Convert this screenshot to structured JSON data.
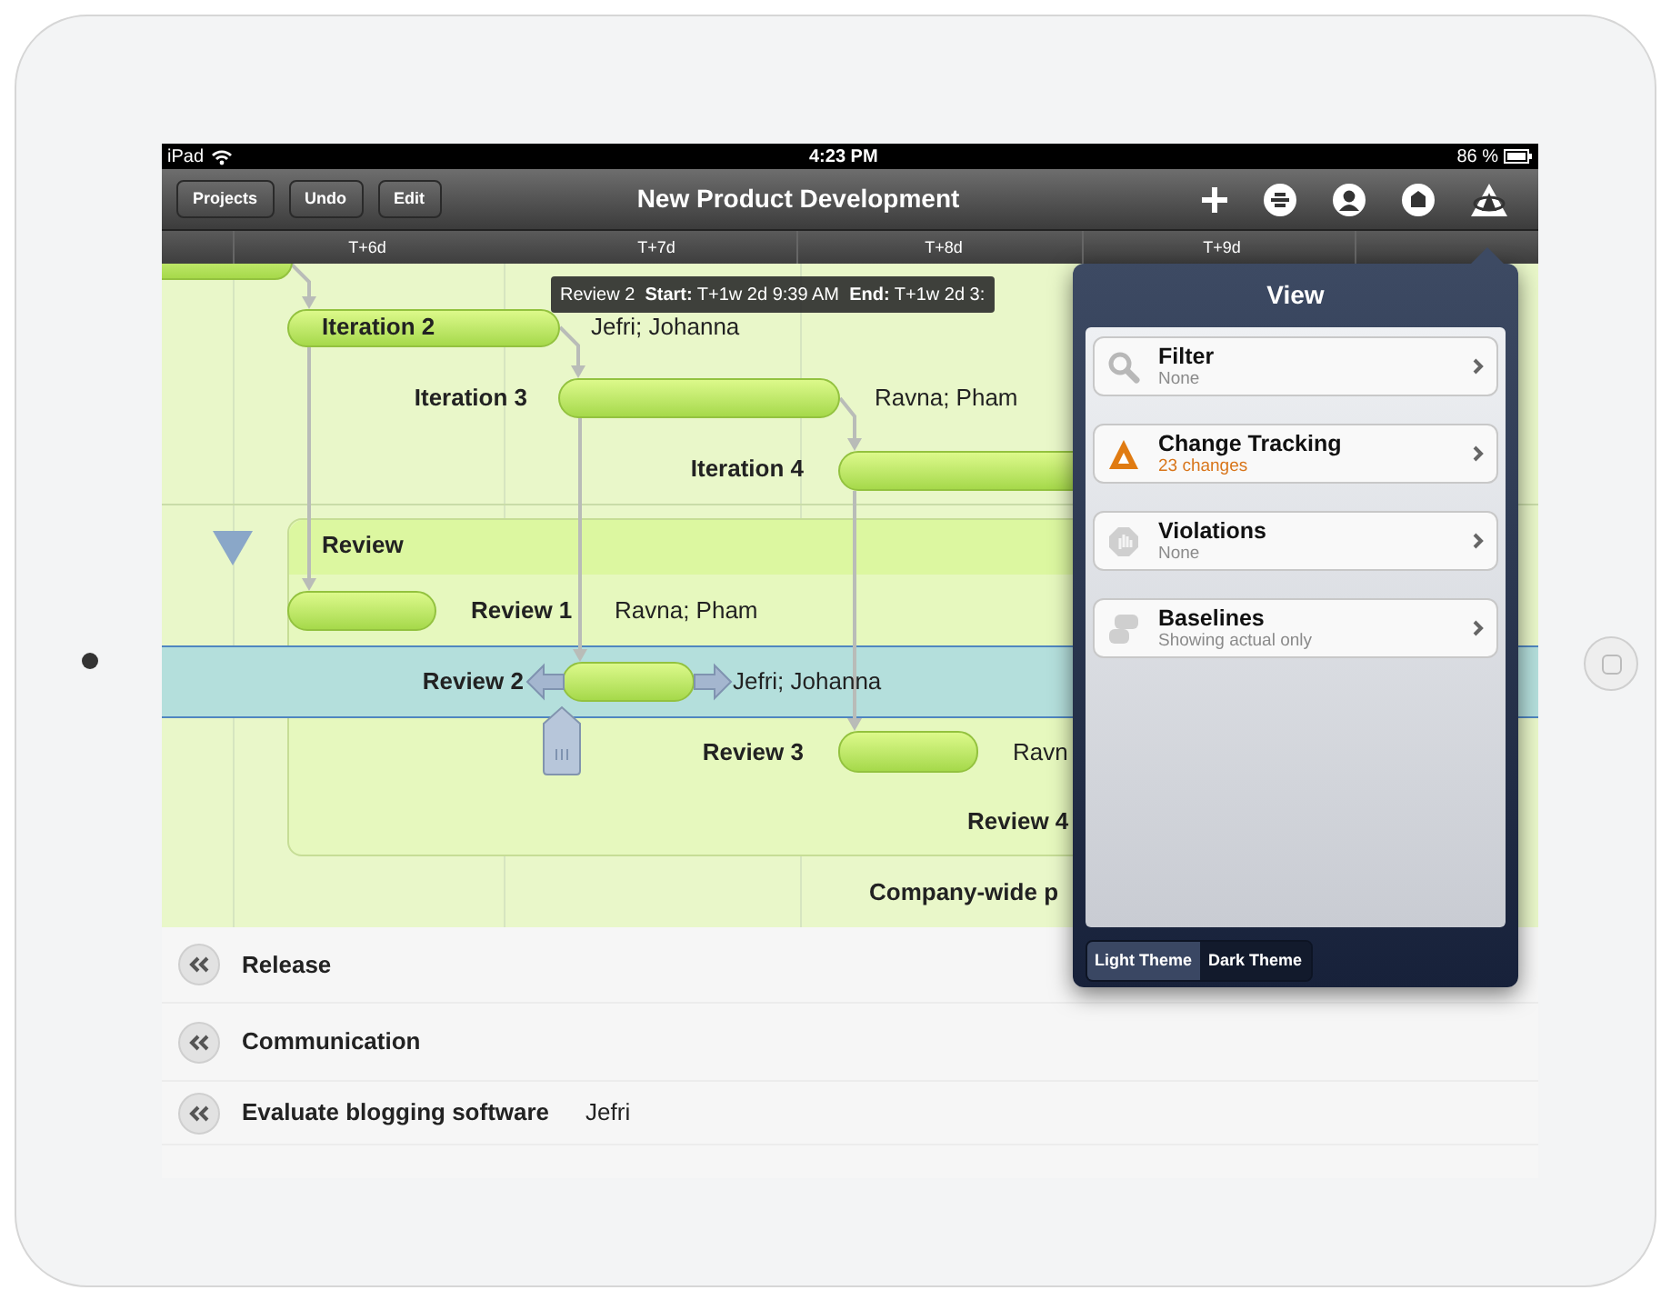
{
  "status_bar": {
    "device": "iPad",
    "time": "4:23 PM",
    "battery": "86 %"
  },
  "toolbar": {
    "buttons": [
      "Projects",
      "Undo",
      "Edit"
    ],
    "title": "New Product Development"
  },
  "timeline": {
    "columns": [
      "T+6d",
      "T+7d",
      "T+8d",
      "T+9d"
    ]
  },
  "tooltip": "Review 2  **Start:** T+1w 2d 9:39 AM  **End:** T+1w 2d 3:",
  "gantt": {
    "tasks": [
      {
        "name": "Iteration 2",
        "assignee": "Jefri; Johanna",
        "selected": false
      },
      {
        "name": "Iteration 3",
        "assignee": "Ravna; Pham",
        "selected": false
      },
      {
        "name": "Iteration 4",
        "selected": false
      }
    ],
    "group": {
      "name": "Review",
      "expanded": true,
      "tasks": [
        {
          "name": "Review 1",
          "assignee": "Ravna; Pham",
          "selected": false
        },
        {
          "name": "Review 2",
          "assignee": "Jefri; Johanna",
          "selected": true
        },
        {
          "name": "Review 3",
          "assignee": "Ravn",
          "selected": false
        },
        {
          "name": "Review 4",
          "selected": false
        }
      ]
    },
    "milestone": "Company-wide p"
  },
  "outline": [
    {
      "name": "Release"
    },
    {
      "name": "Communication"
    },
    {
      "name": "Evaluate blogging software",
      "assignee": "Jefri"
    }
  ],
  "popover": {
    "title": "View",
    "items": [
      {
        "kind": "filter",
        "title": "Filter",
        "detail": "None"
      },
      {
        "kind": "tracking",
        "title": "Change Tracking",
        "detail": "23 changes"
      },
      {
        "kind": "violations",
        "title": "Violations",
        "detail": "None"
      },
      {
        "kind": "baselines",
        "title": "Baselines",
        "detail": "Showing actual only"
      }
    ],
    "themes": [
      {
        "label": "Light Theme",
        "selected": true
      },
      {
        "label": "Dark Theme",
        "selected": false
      }
    ]
  }
}
